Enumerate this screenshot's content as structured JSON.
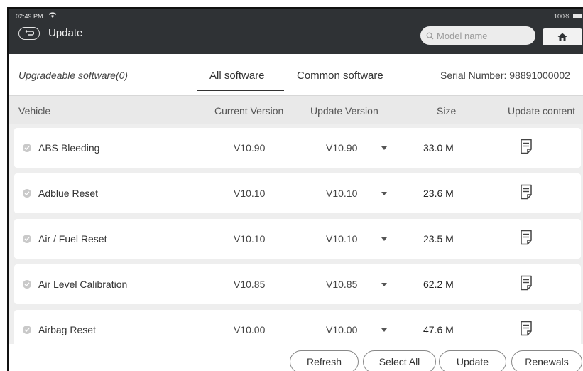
{
  "status_bar": {
    "time": "02:49 PM",
    "battery": "100%"
  },
  "header": {
    "title": "Update",
    "search_placeholder": "Model name"
  },
  "tabs_bar": {
    "upgradeable": "Upgradeable software(0)",
    "tabs": [
      {
        "label": "All software",
        "active": true
      },
      {
        "label": "Common software",
        "active": false
      }
    ],
    "serial": "Serial Number: 98891000002"
  },
  "table": {
    "columns": [
      "Vehicle",
      "Current Version",
      "Update Version",
      "Size",
      "Update content"
    ],
    "rows": [
      {
        "name": "ABS Bleeding",
        "current": "V10.90",
        "update": "V10.90",
        "size": "33.0 M"
      },
      {
        "name": "Adblue Reset",
        "current": "V10.10",
        "update": "V10.10",
        "size": "23.6 M"
      },
      {
        "name": "Air / Fuel Reset",
        "current": "V10.10",
        "update": "V10.10",
        "size": "23.5 M"
      },
      {
        "name": "Air Level Calibration",
        "current": "V10.85",
        "update": "V10.85",
        "size": "62.2 M"
      },
      {
        "name": "Airbag Reset",
        "current": "V10.00",
        "update": "V10.00",
        "size": "47.6 M"
      }
    ]
  },
  "actions": {
    "refresh": "Refresh",
    "select_all": "Select All",
    "update": "Update",
    "renewals": "Renewals"
  },
  "icons": {
    "back": "back-icon",
    "home": "home-icon",
    "search": "search-icon",
    "doc": "document-icon",
    "wifi": "wifi-icon",
    "battery": "battery-icon"
  },
  "colors": {
    "header_bg": "#2f3235",
    "table_header_bg": "#e9e9e9",
    "row_area_bg": "#eeeeee"
  }
}
